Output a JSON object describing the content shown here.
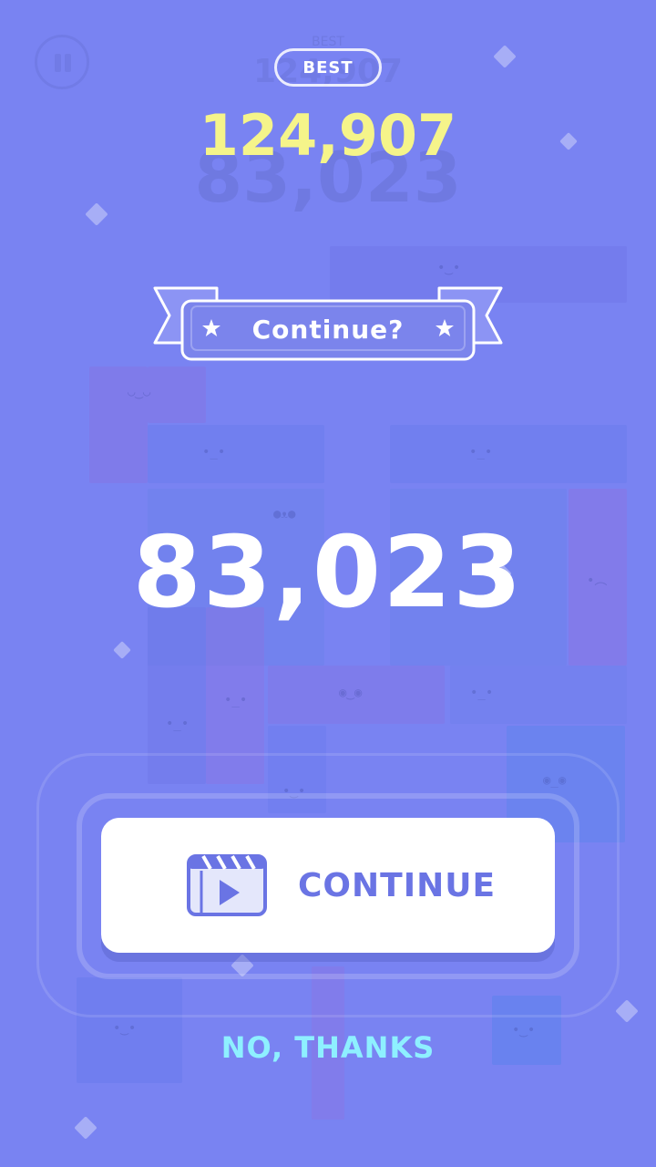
{
  "header": {
    "best_label": "BEST",
    "best_score": "124,907"
  },
  "banner": {
    "title": "Continue?"
  },
  "score": {
    "current": "83,023"
  },
  "actions": {
    "continue_label": "CONTINUE",
    "decline_label": "NO, THANKS"
  },
  "colors": {
    "background": "#7983f2",
    "best_score": "#f5f48a",
    "button_text": "#6a74e4",
    "decline_text": "#8ef0ff"
  },
  "icons": {
    "pause": "pause-icon",
    "star": "star-icon",
    "video": "video-ad-icon"
  }
}
